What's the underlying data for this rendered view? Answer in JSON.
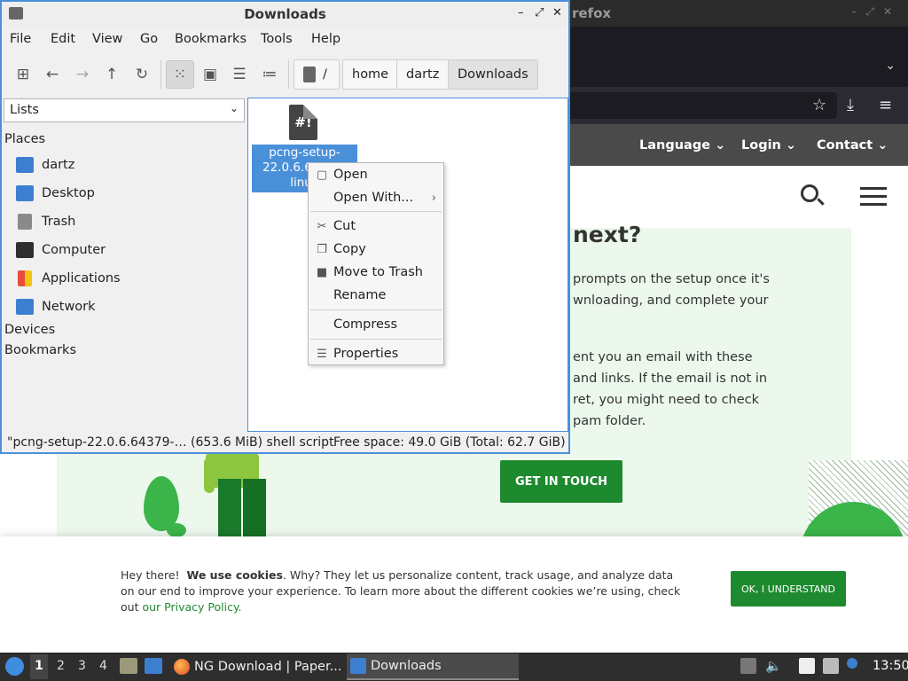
{
  "firefox": {
    "title": "refox",
    "nav_items": [
      "Language",
      "Login",
      "Contact"
    ],
    "heading": "next?",
    "paragraph1": "prompts on the setup once it's wnloading, and complete your",
    "paragraph2": "ent you an email with these and links. If the email is not in ret, you might need to check pam folder.",
    "cta": "GET IN TOUCH",
    "cookie": {
      "greeting": "Hey there!",
      "bold": "We use cookies",
      "text": ". Why? They let us personalize content, track usage, and analyze data on our end to improve your experience. To learn more about the different cookies we’re using, check out",
      "link": "our Privacy Policy.",
      "button": "OK, I UNDERSTAND"
    }
  },
  "file_manager": {
    "title": "Downloads",
    "menu": [
      "File",
      "Edit",
      "View",
      "Go",
      "Bookmarks",
      "Tools",
      "Help"
    ],
    "toolbar_icons": [
      "new-tab-icon",
      "back-icon",
      "forward-icon",
      "up-icon",
      "reload-icon",
      "icon-view-icon",
      "thumbnail-view-icon",
      "compact-view-icon",
      "detail-view-icon"
    ],
    "breadcrumb": [
      "/",
      "home",
      "dartz",
      "Downloads"
    ],
    "sidebar": {
      "mode": "Lists",
      "places_header": "Places",
      "places": [
        {
          "label": "dartz",
          "icon": "home-folder-icon"
        },
        {
          "label": "Desktop",
          "icon": "desktop-icon"
        },
        {
          "label": "Trash",
          "icon": "trash-icon"
        },
        {
          "label": "Computer",
          "icon": "computer-icon"
        },
        {
          "label": "Applications",
          "icon": "applications-icon"
        },
        {
          "label": "Network",
          "icon": "network-icon"
        }
      ],
      "devices_header": "Devices",
      "bookmarks_header": "Bookmarks"
    },
    "file": {
      "icon_text": "#!",
      "name": "pcng-setup-22.0.6.64379-linux"
    },
    "status_left": "\"pcng-setup-22.0.6.64379-… (653.6 MiB) shell script",
    "status_right": "Free space: 49.0 GiB (Total: 62.7 GiB)"
  },
  "context_menu": {
    "items": [
      {
        "label": "Open",
        "icon": "open-icon"
      },
      {
        "label": "Open With...",
        "icon": "",
        "submenu": "›"
      },
      {
        "label": "Cut",
        "icon": "cut-icon"
      },
      {
        "label": "Copy",
        "icon": "copy-icon"
      },
      {
        "label": "Move to Trash",
        "icon": "trash-icon"
      },
      {
        "label": "Rename",
        "icon": ""
      },
      {
        "label": "Compress",
        "icon": ""
      },
      {
        "label": "Properties",
        "icon": "properties-icon"
      }
    ]
  },
  "taskbar": {
    "workspaces": [
      "1",
      "2",
      "3",
      "4"
    ],
    "tasks": [
      {
        "label": "NG Download | Paper...",
        "icon": "firefox-icon"
      },
      {
        "label": "Downloads",
        "icon": "folder-icon"
      }
    ],
    "clock": "13:50"
  }
}
